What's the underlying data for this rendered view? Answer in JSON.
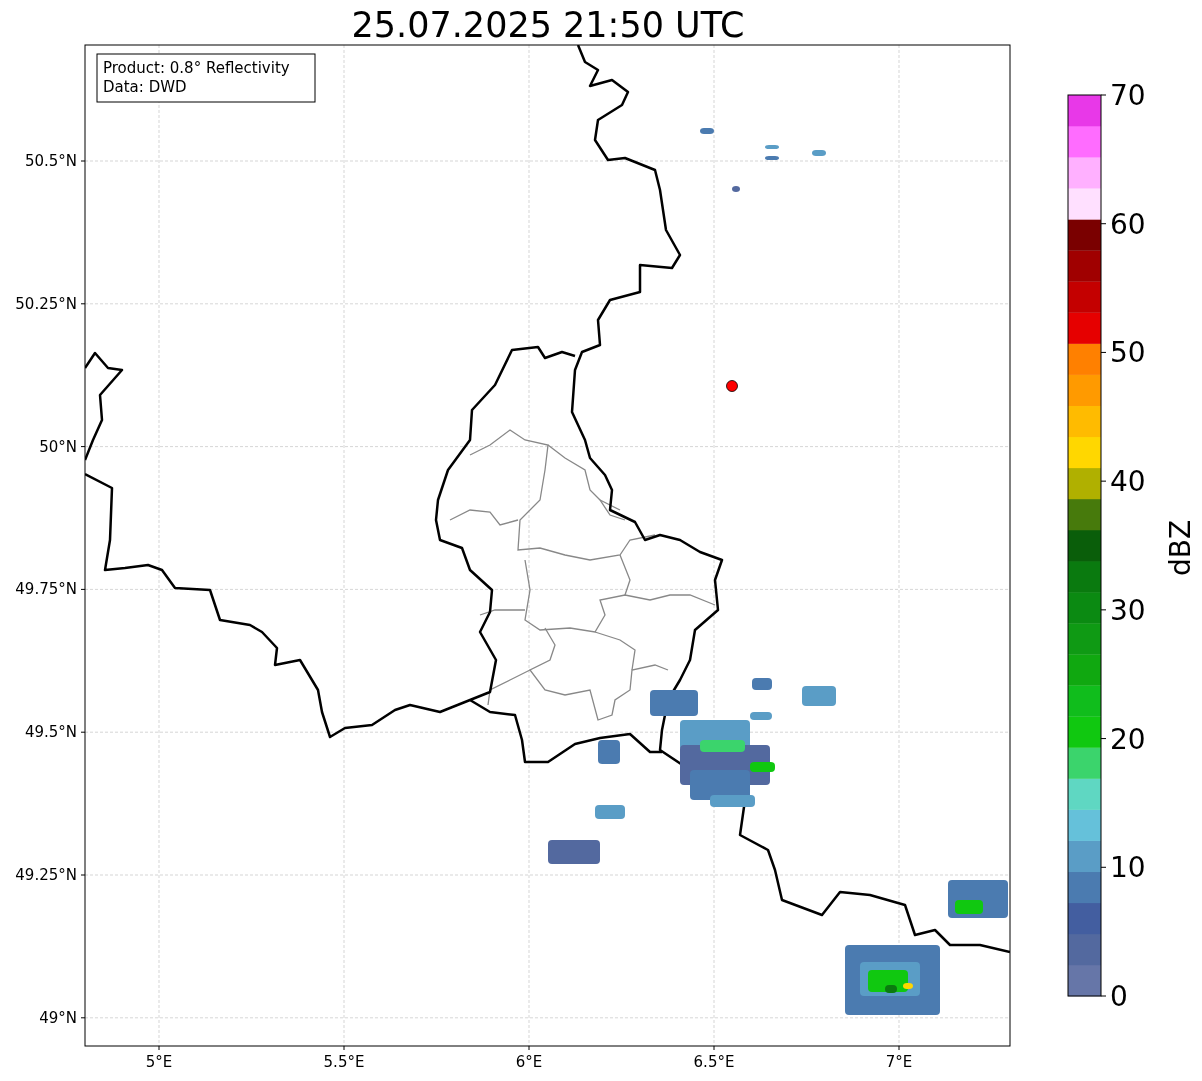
{
  "title": "25.07.2025 21:50 UTC",
  "info_box": [
    "Product: 0.8° Reflectivity",
    "Data: DWD"
  ],
  "map": {
    "x_ticks": [
      "5°E",
      "5.5°E",
      "6°E",
      "6.5°E",
      "7°E"
    ],
    "y_ticks": [
      "50.5°N",
      "50.25°N",
      "50°N",
      "49.75°N",
      "49.5°N",
      "49.25°N",
      "49°N"
    ]
  },
  "colorbar": {
    "label": "dBZ",
    "ticks": [
      "70",
      "60",
      "50",
      "40",
      "30",
      "20",
      "10",
      "0"
    ],
    "segments": [
      {
        "color": "#6676a8"
      },
      {
        "color": "#53699f"
      },
      {
        "color": "#435ea0"
      },
      {
        "color": "#4b7bb0"
      },
      {
        "color": "#5a9dc6"
      },
      {
        "color": "#65c1da"
      },
      {
        "color": "#5fd7c2"
      },
      {
        "color": "#3bd46c"
      },
      {
        "color": "#10c810"
      },
      {
        "color": "#10bd1c"
      },
      {
        "color": "#10a810"
      },
      {
        "color": "#0f9a14"
      },
      {
        "color": "#0b8a12"
      },
      {
        "color": "#0a7a0f"
      },
      {
        "color": "#0a5e0a"
      },
      {
        "color": "#477a0c"
      },
      {
        "color": "#b0b000"
      },
      {
        "color": "#ffd700"
      },
      {
        "color": "#ffbb00"
      },
      {
        "color": "#ff9a00"
      },
      {
        "color": "#ff8000"
      },
      {
        "color": "#e60000"
      },
      {
        "color": "#c40000"
      },
      {
        "color": "#a00000"
      },
      {
        "color": "#7a0000"
      },
      {
        "color": "#ffe0ff"
      },
      {
        "color": "#ffb0ff"
      },
      {
        "color": "#ff6cff"
      },
      {
        "color": "#e838e8"
      }
    ]
  }
}
